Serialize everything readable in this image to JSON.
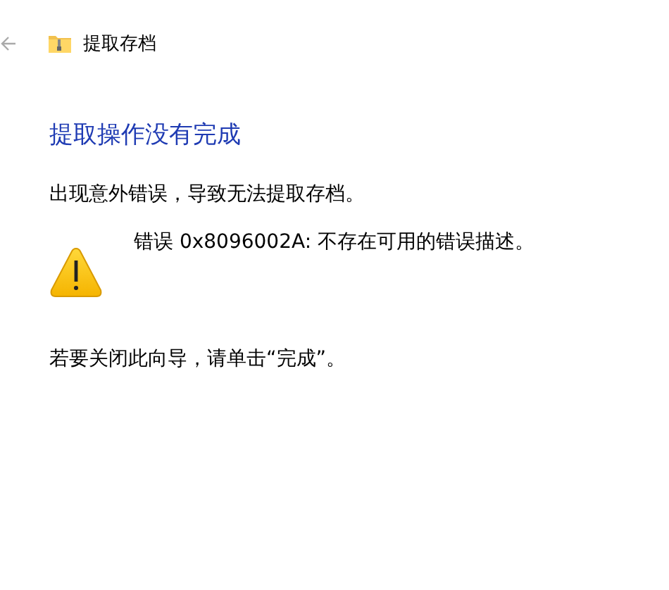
{
  "window": {
    "title": "提取存档"
  },
  "heading": "提取操作没有完成",
  "message": "出现意外错误，导致无法提取存档。",
  "error": {
    "kind": "warning",
    "text": "错误 0x8096002A: 不存在可用的错误描述。"
  },
  "instruction": "若要关闭此向导，请单击“完成”。"
}
